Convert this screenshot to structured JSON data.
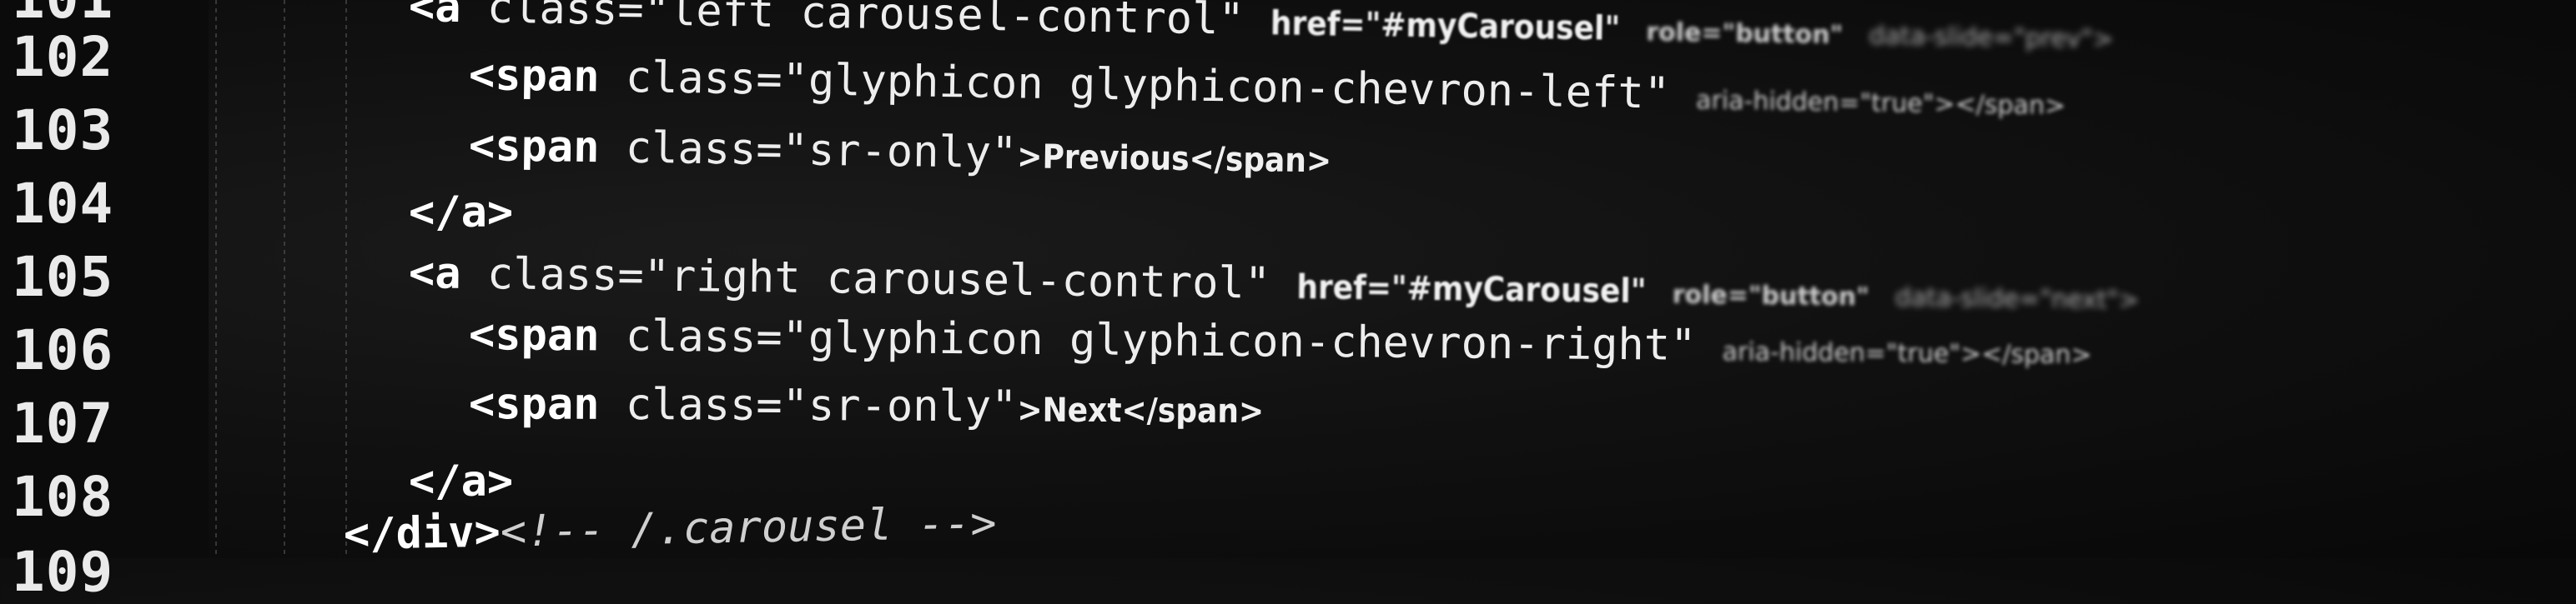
{
  "gutter": {
    "line_numbers": [
      "102",
      "103",
      "104",
      "105",
      "106",
      "107",
      "108"
    ]
  },
  "code": {
    "line_top_partial": [
      "<a",
      "class=\"left carousel-control\"",
      "href=\"#myCarousel\"",
      "role=\"button\"",
      "data-slide=\"prev\">"
    ],
    "line_102": [
      "<span",
      "class=\"glyphicon glyphicon-chevron-left\"",
      "aria-hidden=\"true\"></span>"
    ],
    "line_103": [
      "<span",
      "class=\"sr-only\"",
      ">Previous</span>"
    ],
    "line_104": [
      "</a>"
    ],
    "line_105": [
      "<a",
      "class=\"right carousel-control\"",
      "href=\"#myCarousel\"",
      "role=\"button\"",
      "data-slide=\"next\">"
    ],
    "line_106": [
      "<span",
      "class=\"glyphicon glyphicon-chevron-right\"",
      "aria-hidden=\"true\"></span>"
    ],
    "line_107": [
      "<span",
      "class=\"sr-only\"",
      ">Next</span>"
    ],
    "line_108": [
      "</a>"
    ],
    "line_bottom_partial": [
      "</div>",
      "<!-- /.carousel -->"
    ]
  }
}
